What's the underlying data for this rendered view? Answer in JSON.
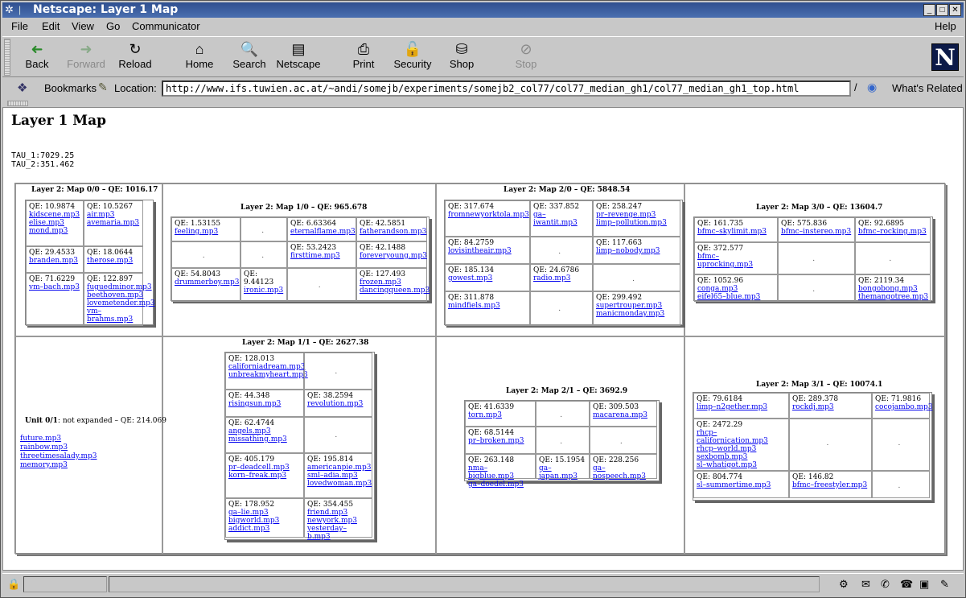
{
  "window": {
    "title": "Netscape: Layer 1 Map"
  },
  "menu": [
    "File",
    "Edit",
    "View",
    "Go",
    "Communicator",
    "Help"
  ],
  "toolbar": [
    {
      "label": "Back",
      "icon": "back-arrow-icon",
      "enabled": true
    },
    {
      "label": "Forward",
      "icon": "forward-arrow-icon",
      "enabled": false
    },
    {
      "label": "Reload",
      "icon": "reload-icon",
      "enabled": true
    },
    {
      "label": "Home",
      "icon": "home-icon",
      "enabled": true
    },
    {
      "label": "Search",
      "icon": "search-icon",
      "enabled": true
    },
    {
      "label": "Netscape",
      "icon": "netscape-icon",
      "enabled": true
    },
    {
      "label": "Print",
      "icon": "print-icon",
      "enabled": true
    },
    {
      "label": "Security",
      "icon": "lock-icon",
      "enabled": true
    },
    {
      "label": "Shop",
      "icon": "shop-icon",
      "enabled": true
    },
    {
      "label": "Stop",
      "icon": "stop-icon",
      "enabled": false
    }
  ],
  "location": {
    "bookmarks": "Bookmarks",
    "label": "Location:",
    "url": "http://www.ifs.tuwien.ac.at/~andi/somejb/experiments/somejb2_col77/col77_median_gh1/col77_median_gh1_top.html",
    "related": "What's Related"
  },
  "page": {
    "title": "Layer 1 Map",
    "tau1": "TAU_1:7029.25",
    "tau2": "TAU_2:351.462",
    "maps": [
      {
        "title": "Layer 2: Map 0/0 – QE: 1016.17",
        "cells": [
          {
            "qe": "QE: 10.9874",
            "songs": [
              "kidscene.mp3",
              "elise.mp3",
              "mond.mp3"
            ]
          },
          {
            "qe": "QE: 10.5267",
            "songs": [
              "air.mp3",
              "avemaria.mp3"
            ]
          },
          {
            "qe": "QE: 29.4533",
            "songs": [
              "branden.mp3"
            ]
          },
          {
            "qe": "QE: 18.0644",
            "songs": [
              "therose.mp3"
            ]
          },
          {
            "qe": "QE: 71.6229",
            "songs": [
              "vm–bach.mp3"
            ]
          },
          {
            "qe": "QE: 122.897",
            "songs": [
              "fuguedminor.mp3",
              "beethoven.mp3",
              "lovemetender.mp3",
              "vm–brahms.mp3"
            ]
          }
        ]
      },
      {
        "title": "Layer 2: Map 1/0 – QE: 965.678",
        "cells": [
          {
            "qe": "QE: 1.53155",
            "songs": [
              "feeling.mp3"
            ]
          },
          {
            "qe": "",
            "songs": []
          },
          {
            "qe": "QE: 6.63364",
            "songs": [
              "eternalflame.mp3"
            ]
          },
          {
            "qe": "QE: 42.5851",
            "songs": [
              "fatherandson.mp3"
            ]
          },
          {
            "qe": "",
            "songs": []
          },
          {
            "qe": "",
            "songs": []
          },
          {
            "qe": "QE: 53.2423",
            "songs": [
              "firsttime.mp3"
            ]
          },
          {
            "qe": "QE: 42.1488",
            "songs": [
              "foreveryoung.mp3"
            ]
          },
          {
            "qe": "QE: 54.8043",
            "songs": [
              "drummerboy.mp3"
            ]
          },
          {
            "qe": "QE: 9.44123",
            "songs": [
              "ironic.mp3"
            ]
          },
          {
            "qe": "",
            "songs": []
          },
          {
            "qe": "QE: 127.493",
            "songs": [
              "frozen.mp3",
              "dancingqueen.mp3"
            ]
          }
        ]
      },
      {
        "title": "Layer 2: Map 2/0 – QE: 5848.54",
        "cells": [
          {
            "qe": "QE: 317.674",
            "songs": [
              "fromnewyorktola.mp3"
            ]
          },
          {
            "qe": "QE: 337.852",
            "songs": [
              "ga–iwantit.mp3"
            ]
          },
          {
            "qe": "QE: 258.247",
            "songs": [
              "pr–revenge.mp3",
              "limp–pollution.mp3"
            ]
          },
          {
            "qe": "QE: 84.2759",
            "songs": [
              "lovisintheair.mp3"
            ]
          },
          {
            "qe": "",
            "songs": []
          },
          {
            "qe": "QE: 117.663",
            "songs": [
              "limp–nobody.mp3"
            ]
          },
          {
            "qe": "QE: 185.134",
            "songs": [
              "gowest.mp3"
            ]
          },
          {
            "qe": "QE: 24.6786",
            "songs": [
              "radio.mp3"
            ]
          },
          {
            "qe": "",
            "songs": []
          },
          {
            "qe": "QE: 311.878",
            "songs": [
              "mindfiels.mp3"
            ]
          },
          {
            "qe": "",
            "songs": []
          },
          {
            "qe": "QE: 299.492",
            "songs": [
              "supertrouper.mp3",
              "manicmonday.mp3"
            ]
          }
        ]
      },
      {
        "title": "Layer 2: Map 3/0 – QE: 13604.7",
        "cells": [
          {
            "qe": "QE: 161.735",
            "songs": [
              "bfmc–skylimit.mp3"
            ]
          },
          {
            "qe": "QE: 575.836",
            "songs": [
              "bfmc–instereo.mp3"
            ]
          },
          {
            "qe": "QE: 92.6895",
            "songs": [
              "bfmc–rocking.mp3"
            ]
          },
          {
            "qe": "QE: 372.577",
            "songs": [
              "bfmc–uprocking.mp3"
            ]
          },
          {
            "qe": "",
            "songs": []
          },
          {
            "qe": "",
            "songs": []
          },
          {
            "qe": "QE: 1052.96",
            "songs": [
              "conga.mp3",
              "eifel65–blue.mp3"
            ]
          },
          {
            "qe": "",
            "songs": []
          },
          {
            "qe": "QE: 2119.34",
            "songs": [
              "bongobong.mp3",
              "themangotree.mp3"
            ]
          }
        ]
      },
      {
        "title": "Layer 2: Map 1/1 – QE: 2627.38",
        "cells": [
          {
            "qe": "QE: 128.013",
            "songs": [
              "californiadream.mp3",
              "unbreakmyheart.mp3"
            ]
          },
          {
            "qe": "",
            "songs": []
          },
          {
            "qe": "QE: 44.348",
            "songs": [
              "risingsun.mp3"
            ]
          },
          {
            "qe": "QE: 38.2594",
            "songs": [
              "revolution.mp3"
            ]
          },
          {
            "qe": "QE: 62.4744",
            "songs": [
              "angels.mp3",
              "missathing.mp3"
            ]
          },
          {
            "qe": "",
            "songs": []
          },
          {
            "qe": "QE: 405.179",
            "songs": [
              "pr–deadcell.mp3",
              "korn–freak.mp3"
            ]
          },
          {
            "qe": "QE: 195.814",
            "songs": [
              "americanpie.mp3",
              "sml–adia.mp3",
              "lovedwoman.mp3"
            ]
          },
          {
            "qe": "QE: 178.952",
            "songs": [
              "ga–lie.mp3",
              "bigworld.mp3",
              "addict.mp3"
            ]
          },
          {
            "qe": "QE: 354.455",
            "songs": [
              "friend.mp3",
              "newyork.mp3",
              "yesterday–b.mp3"
            ]
          }
        ]
      },
      {
        "title": "Layer 2: Map 2/1 – QE: 3692.9",
        "cells": [
          {
            "qe": "QE: 41.6339",
            "songs": [
              "torn.mp3"
            ]
          },
          {
            "qe": "",
            "songs": []
          },
          {
            "qe": "QE: 309.503",
            "songs": [
              "macarena.mp3"
            ]
          },
          {
            "qe": "QE: 68.5144",
            "songs": [
              "pr–broken.mp3"
            ]
          },
          {
            "qe": "",
            "songs": []
          },
          {
            "qe": "",
            "songs": []
          },
          {
            "qe": "QE: 263.148",
            "songs": [
              "nma–bigblue.mp3",
              "ga–doedel.mp3"
            ]
          },
          {
            "qe": "QE: 15.1954",
            "songs": [
              "ga–japan.mp3"
            ]
          },
          {
            "qe": "QE: 228.256",
            "songs": [
              "ga–nospeech.mp3"
            ]
          }
        ]
      },
      {
        "title": "Layer 2: Map 3/1 – QE: 10074.1",
        "cells": [
          {
            "qe": "QE: 79.6184",
            "songs": [
              "limp–n2gether.mp3"
            ]
          },
          {
            "qe": "QE: 289.378",
            "songs": [
              "rockdj.mp3"
            ]
          },
          {
            "qe": "QE: 71.9816",
            "songs": [
              "cocojambo.mp3"
            ]
          },
          {
            "qe": "QE: 2472.29",
            "songs": [
              "rhcp–californication.mp3",
              "rhcp–world.mp3",
              "sexbomb.mp3",
              "sl–whatigot.mp3"
            ]
          },
          {
            "qe": "",
            "songs": []
          },
          {
            "qe": "",
            "songs": []
          },
          {
            "qe": "QE: 804.774",
            "songs": [
              "sl–summertime.mp3"
            ]
          },
          {
            "qe": "QE: 146.82",
            "songs": [
              "bfmc–freestyler.mp3"
            ]
          },
          {
            "qe": "",
            "songs": []
          }
        ]
      }
    ],
    "unit01": {
      "label": "Unit 0/1",
      "note": ": not expanded – QE: 214.069",
      "songs": [
        "future.mp3",
        "rainbow.mp3",
        "threetimesalady.mp3",
        "memory.mp3"
      ]
    }
  }
}
